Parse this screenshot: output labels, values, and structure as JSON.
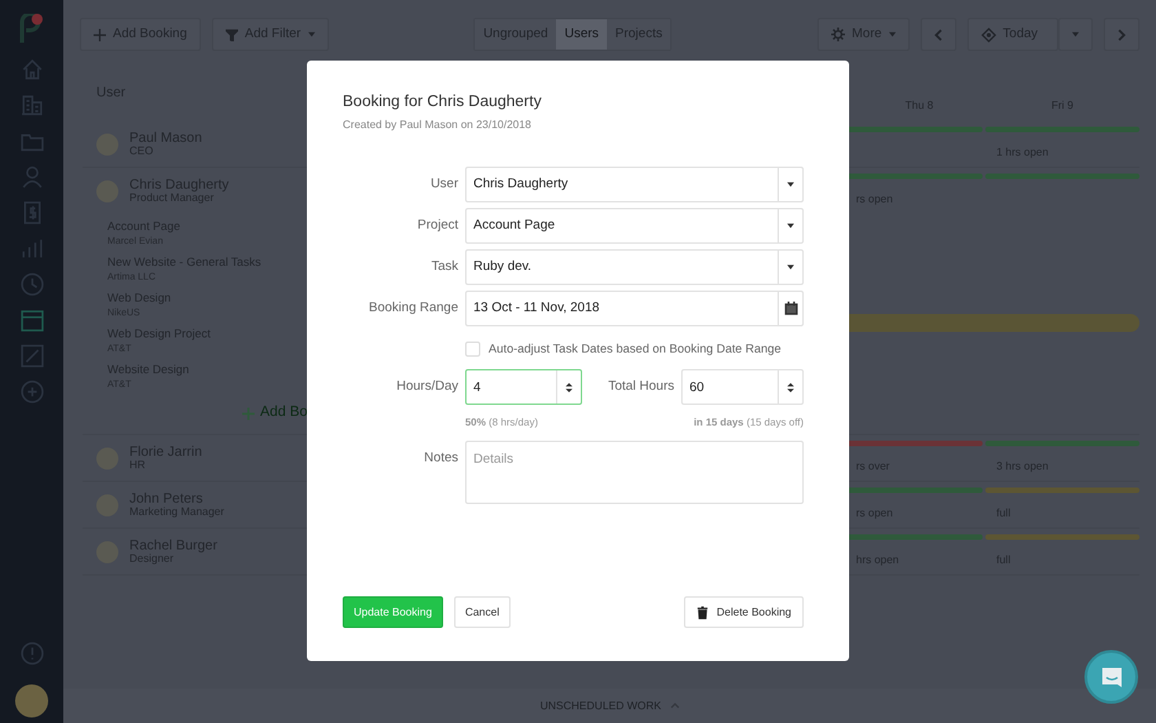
{
  "sidebar": {
    "items": [
      {
        "selected": false
      },
      {
        "selected": false
      },
      {
        "selected": false
      },
      {
        "selected": false
      },
      {
        "selected": false
      },
      {
        "selected": false
      },
      {
        "selected": false
      },
      {
        "selected": true
      },
      {
        "selected": false
      },
      {
        "selected": false
      }
    ]
  },
  "toolbar": {
    "add_booking": "Add Booking",
    "add_filter": "Add Filter",
    "groupings": [
      {
        "label": "Ungrouped",
        "selected": false
      },
      {
        "label": "Users",
        "selected": true
      },
      {
        "label": "Projects",
        "selected": false
      }
    ],
    "more": "More",
    "today": "Today"
  },
  "schedule": {
    "header": "User",
    "days": [
      "Thu 8",
      "Fri 9"
    ],
    "users": [
      {
        "name": "Paul Mason",
        "role": "CEO",
        "cells": [
          {
            "color": "#2f5a3b"
          },
          {
            "text": "1 hrs open",
            "color": "#2f5a3b"
          }
        ]
      },
      {
        "name": "Chris Daugherty",
        "role": "Product Manager",
        "cells": [
          {
            "text": "rs open",
            "color": "#2f5a3b"
          },
          {
            "color": "#2f5a3b"
          }
        ],
        "tasks": [
          {
            "name": "Account Page",
            "client": "Marcel Evian"
          },
          {
            "name": "New Website - General Tasks",
            "client": "Artima LLC"
          },
          {
            "name": "Web Design",
            "client": "NikeUS"
          },
          {
            "name": "Web Design Project",
            "client": "AT&T"
          },
          {
            "name": "Website Design",
            "client": "AT&T"
          }
        ],
        "add_booking": "Add Bo"
      },
      {
        "name": "Florie Jarrin",
        "role": "HR",
        "cells": [
          {
            "text": "rs over",
            "color": "#6b3236"
          },
          {
            "text": "3 hrs open",
            "color": "#2f5a3b"
          }
        ]
      },
      {
        "name": "John Peters",
        "role": "Marketing Manager",
        "cells": [
          {
            "text": "rs open",
            "color": "#2f5a3b"
          },
          {
            "text": "full",
            "color": "#5d5633"
          }
        ]
      },
      {
        "name": "Rachel Burger",
        "role": "Designer",
        "cells": [
          {
            "text": "hrs open",
            "color": "#2f5a3b"
          },
          {
            "text": "full",
            "color": "#5d5633"
          }
        ]
      }
    ]
  },
  "unscheduled": "UNSCHEDULED WORK",
  "modal": {
    "title": "Booking for Chris Daugherty",
    "subtitle": "Created by Paul Mason on 23/10/2018",
    "fields": [
      {
        "label": "User",
        "value": "Chris Daugherty",
        "kind": "select"
      },
      {
        "label": "Project",
        "value": "Account Page",
        "kind": "select"
      },
      {
        "label": "Task",
        "value": "Ruby dev.",
        "kind": "select"
      },
      {
        "label": "Booking Range",
        "value": "13 Oct - 11 Nov, 2018",
        "kind": "date"
      }
    ],
    "auto_adjust": {
      "label": "Auto-adjust Task Dates based on Booking Date Range",
      "checked": false
    },
    "hours_per_day": {
      "label": "Hours/Day",
      "value": "4",
      "focused": true,
      "hint": "**50%** (8 hrs/day)"
    },
    "total_hours": {
      "label": "Total Hours",
      "value": "60",
      "focused": false,
      "hint": "**in 15 days** (15 days off)"
    },
    "notes": {
      "label": "Notes",
      "placeholder": "Details"
    },
    "buttons": {
      "update": "Update Booking",
      "cancel": "Cancel",
      "delete": "Delete Booking"
    }
  }
}
